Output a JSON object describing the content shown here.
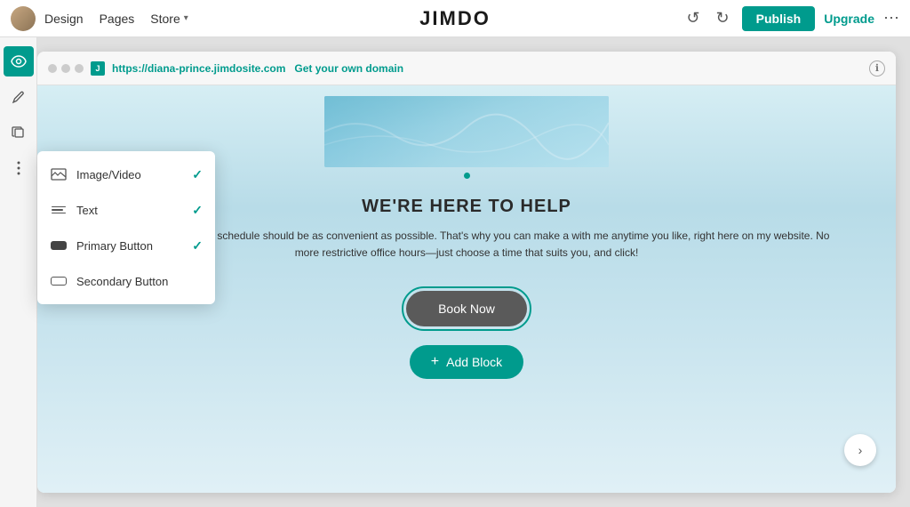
{
  "nav": {
    "design_label": "Design",
    "pages_label": "Pages",
    "store_label": "Store",
    "logo_text": "JIMDO",
    "publish_label": "Publish",
    "upgrade_label": "Upgrade"
  },
  "sidebar": {
    "icons": [
      {
        "name": "eye-icon",
        "symbol": "👁",
        "active": true
      },
      {
        "name": "pen-tool-icon",
        "symbol": "✒",
        "active": false
      },
      {
        "name": "copy-icon",
        "symbol": "⧉",
        "active": false
      },
      {
        "name": "more-icon",
        "symbol": "⋮",
        "active": false
      }
    ]
  },
  "browser": {
    "url_prefix": "https://",
    "url_domain": "diana-prince.jimdosite.com",
    "url_cta": "Get your own domain",
    "favicon_letter": "J"
  },
  "site": {
    "heading": "WE'RE HERE TO HELP",
    "body_text": "usy. So organizing your schedule should be as convenient as possible. That's why you can make a with me anytime you like, right here on my website. No more restrictive office hours—just choose a time that suits you, and click!",
    "book_now_label": "Book Now",
    "add_block_label": "Add Block"
  },
  "dropdown": {
    "items": [
      {
        "id": "image-video",
        "label": "Image/Video",
        "checked": true
      },
      {
        "id": "text",
        "label": "Text",
        "checked": true
      },
      {
        "id": "primary-button",
        "label": "Primary Button",
        "checked": true
      },
      {
        "id": "secondary-button",
        "label": "Secondary Button",
        "checked": false
      }
    ]
  },
  "colors": {
    "brand": "#009b8d",
    "publish_bg": "#009b8d"
  }
}
